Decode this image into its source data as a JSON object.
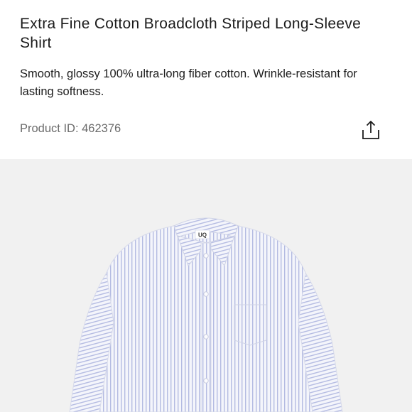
{
  "product": {
    "title": "Extra Fine Cotton Broadcloth Striped Long-Sleeve Shirt",
    "description": "Smooth, glossy 100% ultra-long fiber cotton. Wrinkle-resistant for lasting softness.",
    "product_id_label": "Product ID: 462376"
  },
  "actions": {
    "share_icon": "share-icon"
  },
  "image": {
    "brand_tag": "UQ"
  },
  "colors": {
    "image_background": "#f1f1f1",
    "shirt_stripe": "#9aa3d6",
    "text_secondary": "#6b6b6b"
  }
}
